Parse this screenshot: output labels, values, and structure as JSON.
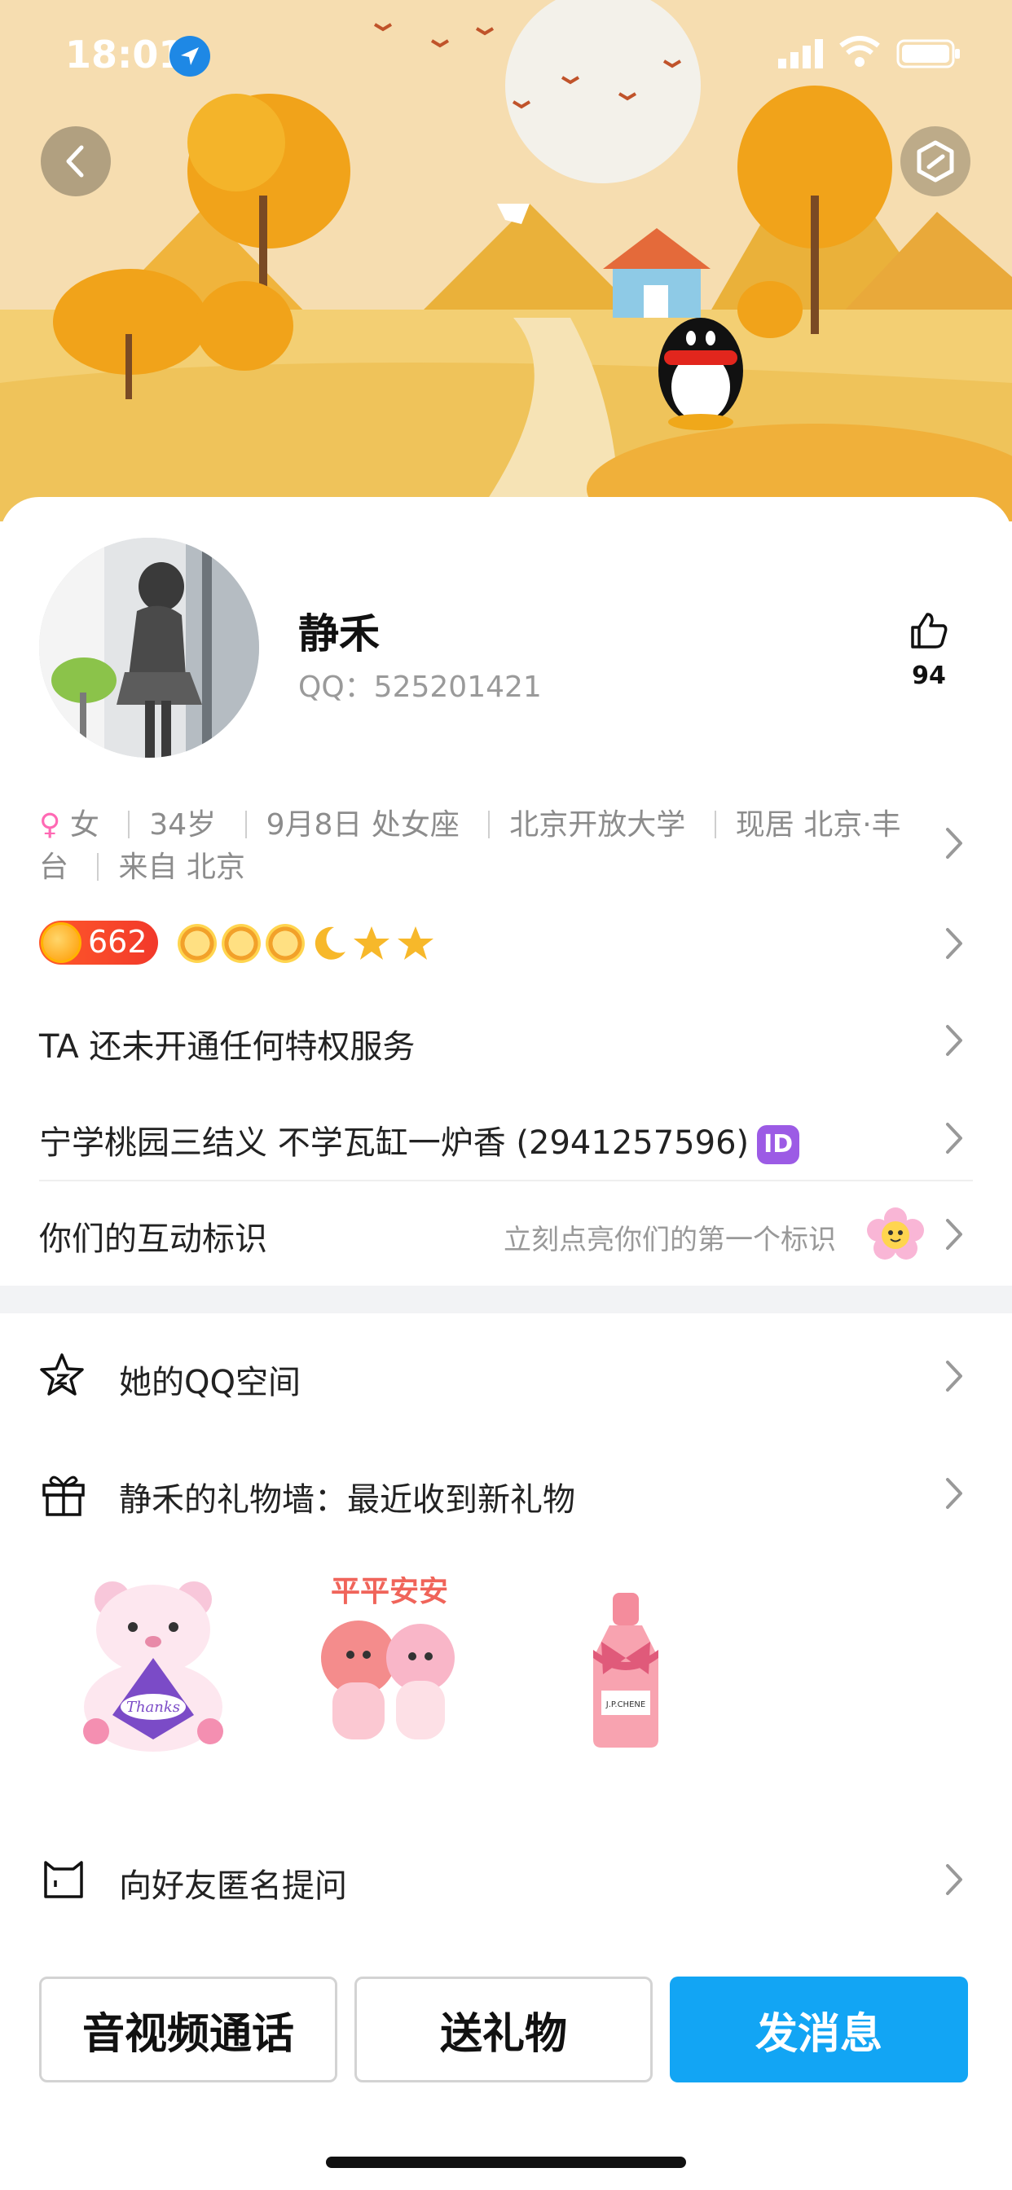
{
  "status_bar": {
    "time": "18:01"
  },
  "profile": {
    "name": "静禾",
    "qq_label": "QQ：525201421",
    "likes": "94"
  },
  "info": {
    "gender": "女",
    "age": "34岁",
    "birthday": "9月8日 处女座",
    "school": "北京开放大学",
    "residence_line1_end": "现居 北京·丰",
    "residence_line2_start": "台",
    "hometown": "来自 北京"
  },
  "level": {
    "value": "662"
  },
  "rows": {
    "privilege": "TA 还未开通任何特权服务",
    "signature": "宁学桃园三结义 不学瓦缸一炉香 (2941257596)",
    "signature_badge": "ID",
    "interaction": "你们的互动标识",
    "interaction_hint": "立刻点亮你们的第一个标识",
    "qzone": "她的QQ空间",
    "gift_wall": "静禾的礼物墙：最近收到新礼物",
    "anon_question": "向好友匿名提问"
  },
  "gifts": {
    "gift1_text": "Thanks",
    "gift2_text": "平平安安",
    "gift3_text": "J.P.CHENE"
  },
  "buttons": {
    "call": "音视频通话",
    "gift": "送礼物",
    "message": "发消息"
  },
  "colors": {
    "primary": "#12a5f4",
    "level_badge": "#f2392a",
    "id_badge": "#9c5be5",
    "gender": "#ff69b4"
  }
}
